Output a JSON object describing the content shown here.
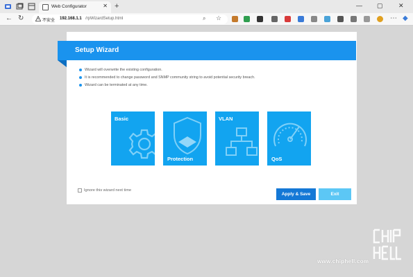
{
  "browser": {
    "tab_title": "Web Configurator",
    "tab_close": "✕",
    "new_tab": "+",
    "address": {
      "security_label": "不安全",
      "host": "192.168.1.1",
      "path": "/rpWizardSetup.html"
    },
    "window_controls": [
      "—",
      "▢",
      "✕"
    ]
  },
  "wizard": {
    "title": "Setup Wizard",
    "notes": [
      "Wizard will overwrite the existing configuration.",
      "It is recommended to change password and SNMP community string to avoid potential security breach.",
      "Wizard can be terminated at any time."
    ],
    "tiles": [
      {
        "label": "Basic",
        "icon": "gear-icon"
      },
      {
        "label": "Protection",
        "icon": "shield-icon"
      },
      {
        "label": "VLAN",
        "icon": "network-icon"
      },
      {
        "label": "QoS",
        "icon": "speedometer-icon"
      }
    ],
    "ignore_label": "Ignore this wizard next time",
    "apply_label": "Apply & Save",
    "exit_label": "Exit"
  },
  "watermark": {
    "site": "www.chiphell.com"
  },
  "colors": {
    "accent": "#1a93ee",
    "tile": "#12a4f0",
    "apply": "#1478d6",
    "exit": "#5cc7f5"
  }
}
